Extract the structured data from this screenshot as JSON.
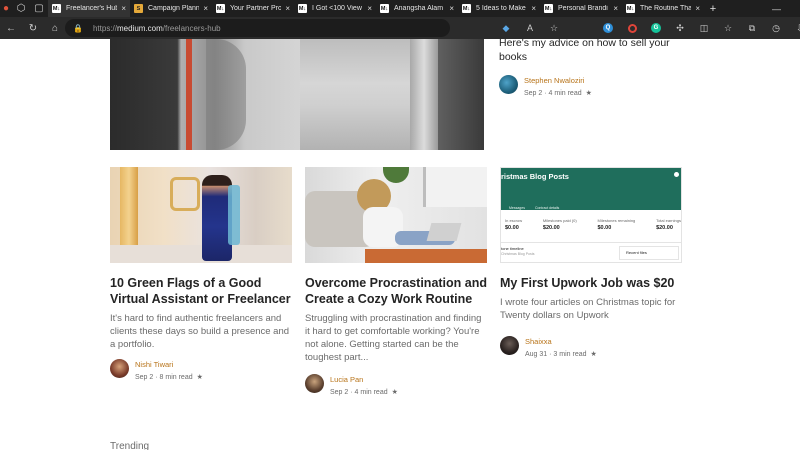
{
  "browser": {
    "tabs": [
      {
        "favicon": "M↓",
        "title": "Freelancer's Hub",
        "active": true
      },
      {
        "favicon": "S",
        "title": "Campaign Planni",
        "active": false
      },
      {
        "favicon": "M↓",
        "title": "Your Partner Pro",
        "active": false
      },
      {
        "favicon": "M↓",
        "title": "I Got <100 View",
        "active": false
      },
      {
        "favicon": "M↓",
        "title": "Anangsha Alam",
        "active": false
      },
      {
        "favicon": "M↓",
        "title": "5 Ideas to Make",
        "active": false
      },
      {
        "favicon": "M↓",
        "title": "Personal Brandi",
        "active": false
      },
      {
        "favicon": "M↓",
        "title": "The Routine Tha",
        "active": false
      }
    ],
    "close_glyph": "×",
    "new_tab_glyph": "+",
    "address": {
      "scheme": "https://",
      "host": "medium.com",
      "path": "/freelancers-hub"
    }
  },
  "page": {
    "featured_side": {
      "snippet": "Here's my advice on how to sell your books",
      "author": "Stephen Nwaloziri",
      "date": "Sep 2",
      "read_time": "4 min read",
      "star": "★"
    },
    "cards": [
      {
        "title": "10 Green Flags of a Good Virtual Assistant or Freelancer",
        "subtitle": "It's hard to find authentic freelancers and clients these days so build a presence and a portfolio.",
        "author": "Nishi Tiwari",
        "date": "Sep 2",
        "read_time": "8 min read",
        "star": "★"
      },
      {
        "title": "Overcome Procrastination and Create a Cozy Work Routine",
        "subtitle": "Struggling with procrastination and finding it hard to get comfortable working? You're not alone. Getting started can be the toughest part...",
        "author": "Lucia Pan",
        "date": "Sep 2",
        "read_time": "4 min read",
        "star": "★"
      },
      {
        "title": "My First Upwork Job was $20",
        "subtitle": "I wrote four articles on Christmas topic for Twenty dollars on Upwork",
        "author": "Shaixxa",
        "date": "Aug 31",
        "read_time": "3 min read",
        "star": "★"
      }
    ],
    "thumb3": {
      "title": "ristmas Blog Posts",
      "tabs": [
        "Messages",
        "Contract details"
      ],
      "stats": [
        {
          "label": "In escrow",
          "value": "$0.00"
        },
        {
          "label": "Milestones paid (0)",
          "value": "$20.00"
        },
        {
          "label": "Milestones remaining",
          "value": "$0.00"
        },
        {
          "label": "Total earnings",
          "value": "$20.00"
        }
      ],
      "timeline": "tone timeline",
      "timeline_sub": "Christmas Blog Posts",
      "recent": "Recent files"
    },
    "trending_label": "Trending"
  }
}
